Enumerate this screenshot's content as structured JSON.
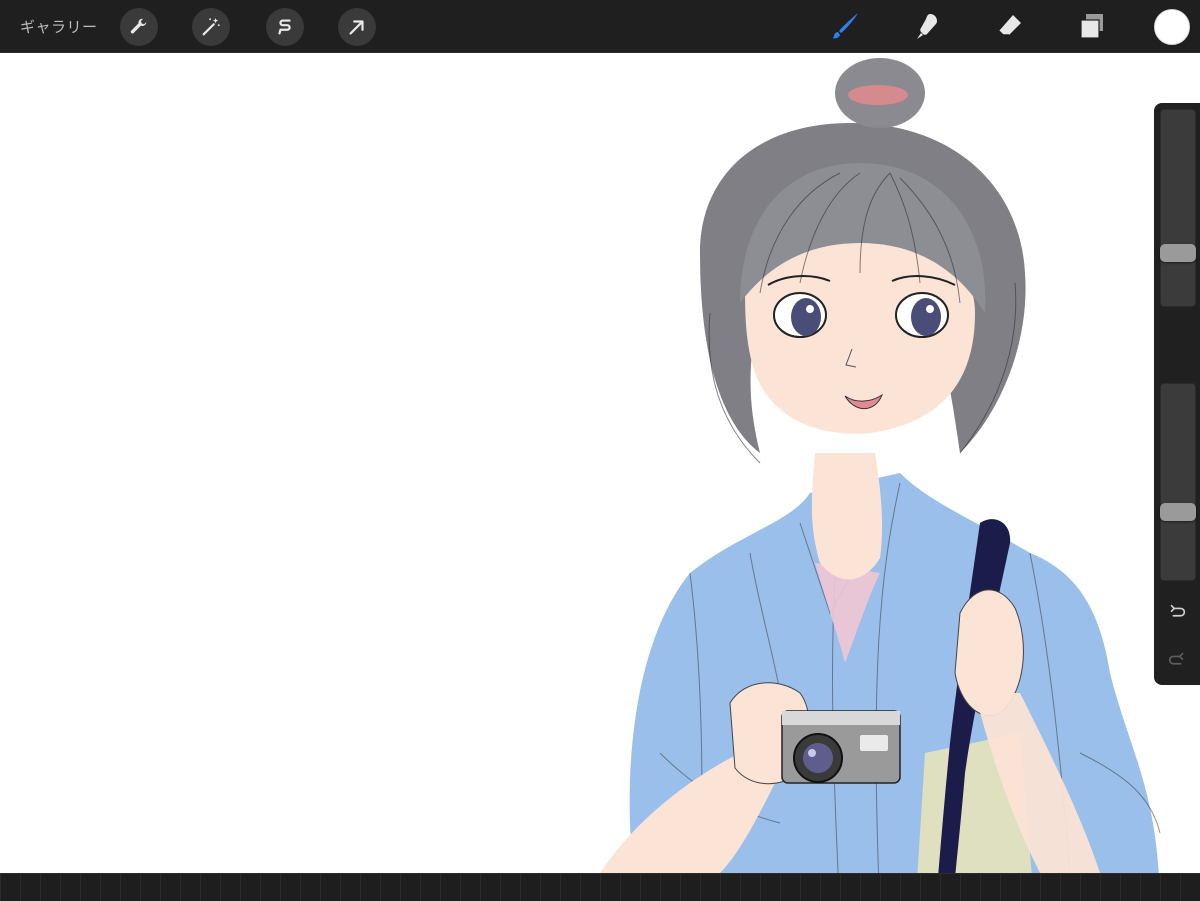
{
  "toolbar": {
    "gallery_label": "ギャラリー",
    "left_tools": [
      "wrench-icon",
      "magic-wand-icon",
      "selection-icon",
      "transform-arrow-icon"
    ],
    "right_tools": [
      "brush-icon",
      "smudge-icon",
      "eraser-icon",
      "layers-icon"
    ],
    "active_tool": "brush",
    "active_color": "#ffffff",
    "accent_color": "#2f80ed"
  },
  "sidebar": {
    "brush_size_level": 0.25,
    "opacity_level": 0.33,
    "undo_icon": "undo-icon",
    "redo_icon": "redo-icon"
  },
  "canvas": {
    "background": "#ffffff",
    "artwork": "sketch-girl-with-camera"
  }
}
